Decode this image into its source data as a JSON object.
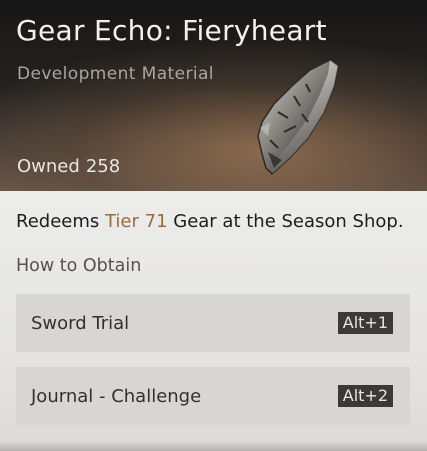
{
  "item": {
    "name": "Gear Echo: Fieryheart",
    "type": "Development Material",
    "owned_label": "Owned",
    "owned_count": "258",
    "icon": "shield-fragment-icon"
  },
  "description": {
    "prefix": "Redeems ",
    "tier": "Tier 71",
    "suffix": " Gear at the Season Shop."
  },
  "how_to_obtain": {
    "heading": "How to Obtain",
    "sources": [
      {
        "label": "Sword Trial",
        "hotkey": "Alt+1"
      },
      {
        "label": "Journal - Challenge",
        "hotkey": "Alt+2"
      }
    ]
  },
  "colors": {
    "tier_accent": "#9a6a3c",
    "hotkey_bg": "#3c3a38",
    "row_bg": "#d7d6d4"
  }
}
